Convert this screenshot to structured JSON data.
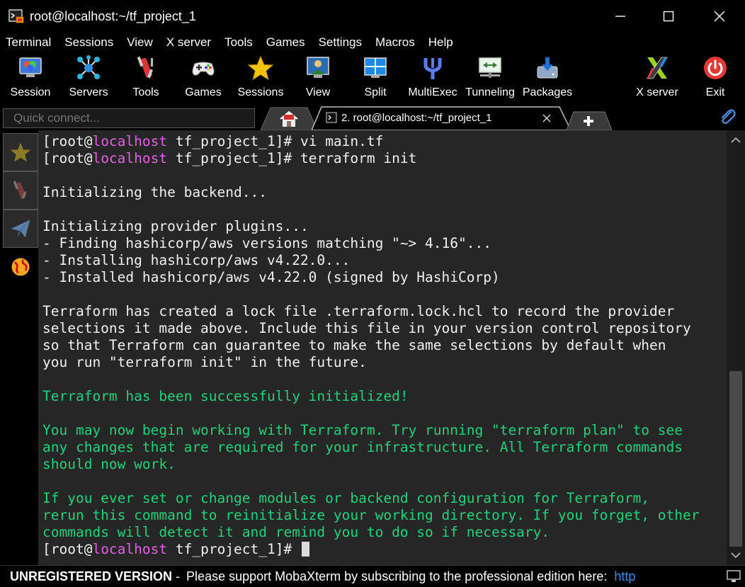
{
  "window": {
    "title": "root@localhost:~/tf_project_1",
    "minimize_icon": "minimize-icon",
    "maximize_icon": "maximize-icon",
    "close_icon": "close-icon"
  },
  "menu": [
    "Terminal",
    "Sessions",
    "View",
    "X server",
    "Tools",
    "Games",
    "Settings",
    "Macros",
    "Help"
  ],
  "toolbar": {
    "session": "Session",
    "servers": "Servers",
    "tools": "Tools",
    "games": "Games",
    "sessions": "Sessions",
    "view": "View",
    "split": "Split",
    "multiexec": "MultiExec",
    "tunneling": "Tunneling",
    "packages": "Packages",
    "xserver": "X server",
    "exit": "Exit"
  },
  "tabs": {
    "quick_connect_placeholder": "Quick connect...",
    "active_tab_label": "2. root@localhost:~/tf_project_1"
  },
  "terminal": {
    "prompt_user": "root",
    "prompt_host": "localhost",
    "prompt_dir": "tf_project_1",
    "lines": [
      {
        "type": "prompt",
        "cmd": "vi main.tf"
      },
      {
        "type": "prompt",
        "cmd": "terraform init"
      },
      {
        "type": "blank"
      },
      {
        "type": "white",
        "text": "Initializing the backend..."
      },
      {
        "type": "blank"
      },
      {
        "type": "white",
        "text": "Initializing provider plugins..."
      },
      {
        "type": "white",
        "text": "- Finding hashicorp/aws versions matching \"~> 4.16\"..."
      },
      {
        "type": "white",
        "text": "- Installing hashicorp/aws v4.22.0..."
      },
      {
        "type": "white",
        "text": "- Installed hashicorp/aws v4.22.0 (signed by HashiCorp)"
      },
      {
        "type": "blank"
      },
      {
        "type": "white",
        "text": "Terraform has created a lock file .terraform.lock.hcl to record the provider"
      },
      {
        "type": "white",
        "text": "selections it made above. Include this file in your version control repository"
      },
      {
        "type": "white",
        "text": "so that Terraform can guarantee to make the same selections by default when"
      },
      {
        "type": "white",
        "text": "you run \"terraform init\" in the future."
      },
      {
        "type": "blank"
      },
      {
        "type": "green",
        "text": "Terraform has been successfully initialized!"
      },
      {
        "type": "blank"
      },
      {
        "type": "green",
        "text": "You may now begin working with Terraform. Try running \"terraform plan\" to see"
      },
      {
        "type": "green",
        "text": "any changes that are required for your infrastructure. All Terraform commands"
      },
      {
        "type": "green",
        "text": "should now work."
      },
      {
        "type": "blank"
      },
      {
        "type": "green",
        "text": "If you ever set or change modules or backend configuration for Terraform,"
      },
      {
        "type": "green",
        "text": "rerun this command to reinitialize your working directory. If you forget, other"
      },
      {
        "type": "green",
        "text": "commands will detect it and remind you to do so if necessary."
      },
      {
        "type": "prompt",
        "cmd": "",
        "cursor": true
      }
    ]
  },
  "status": {
    "unregistered": "UNREGISTERED VERSION",
    "separator": " - ",
    "message": "Please support MobaXterm by subscribing to the professional edition here:",
    "link": "http"
  },
  "colors": {
    "terminal_bg": "#262626",
    "green": "#1fd37c",
    "magenta": "#e45ee8",
    "link": "#3b8ded"
  }
}
